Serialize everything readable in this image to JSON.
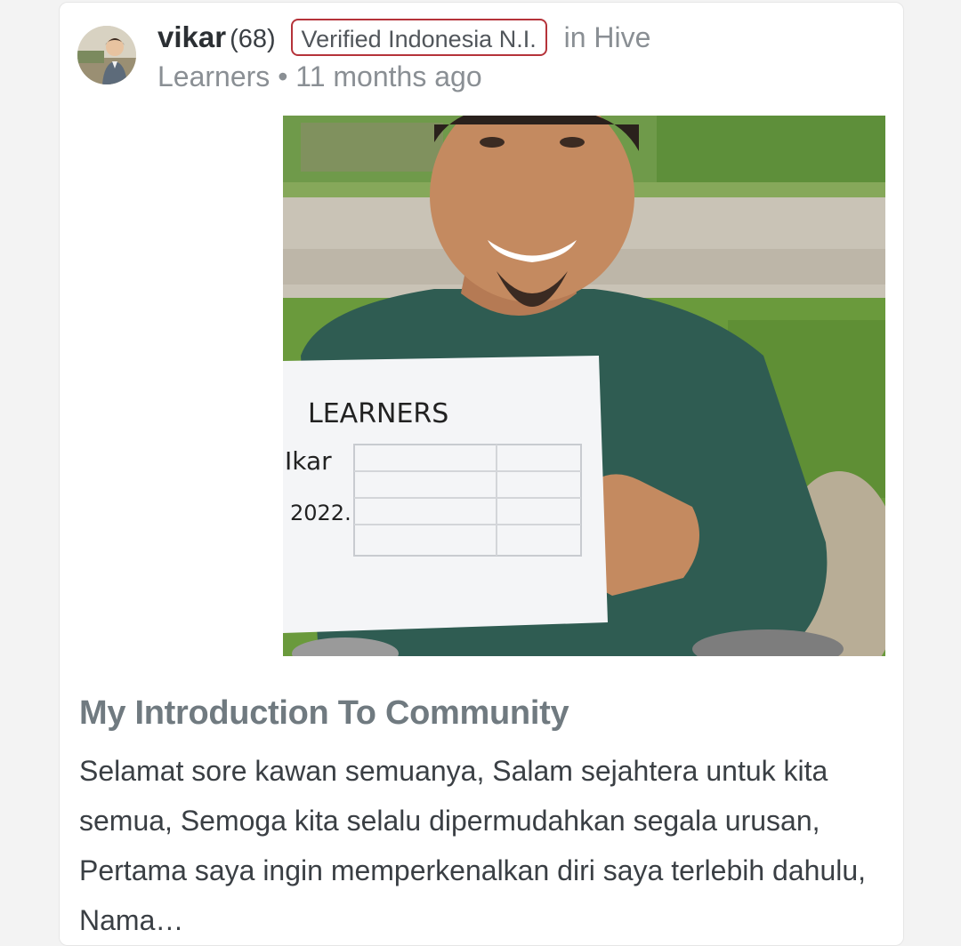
{
  "post": {
    "author": "vikar",
    "reputation": "(68)",
    "badge": "Verified Indonesia N.I.",
    "community_prefix": "in",
    "community": "Hive Learners",
    "time_separator": "•",
    "time": "11 months ago",
    "image_sign_text": {
      "line1": "LEARNERS",
      "line2": "Ikar",
      "line3": "2022."
    },
    "title": "My Introduction To Community",
    "excerpt": "Selamat sore kawan semuanya, Salam sejahtera untuk kita semua, Semoga kita selalu dipermudahkan segala urusan, Pertama saya ingin memperkenalkan diri saya terlebih dahulu, Nama…"
  },
  "colors": {
    "badge_border": "#b5333a",
    "title": "#707a80",
    "body_text": "#3a3f44",
    "meta_text": "#8a8f94"
  },
  "icons": {
    "avatar": "user-avatar-icon"
  }
}
